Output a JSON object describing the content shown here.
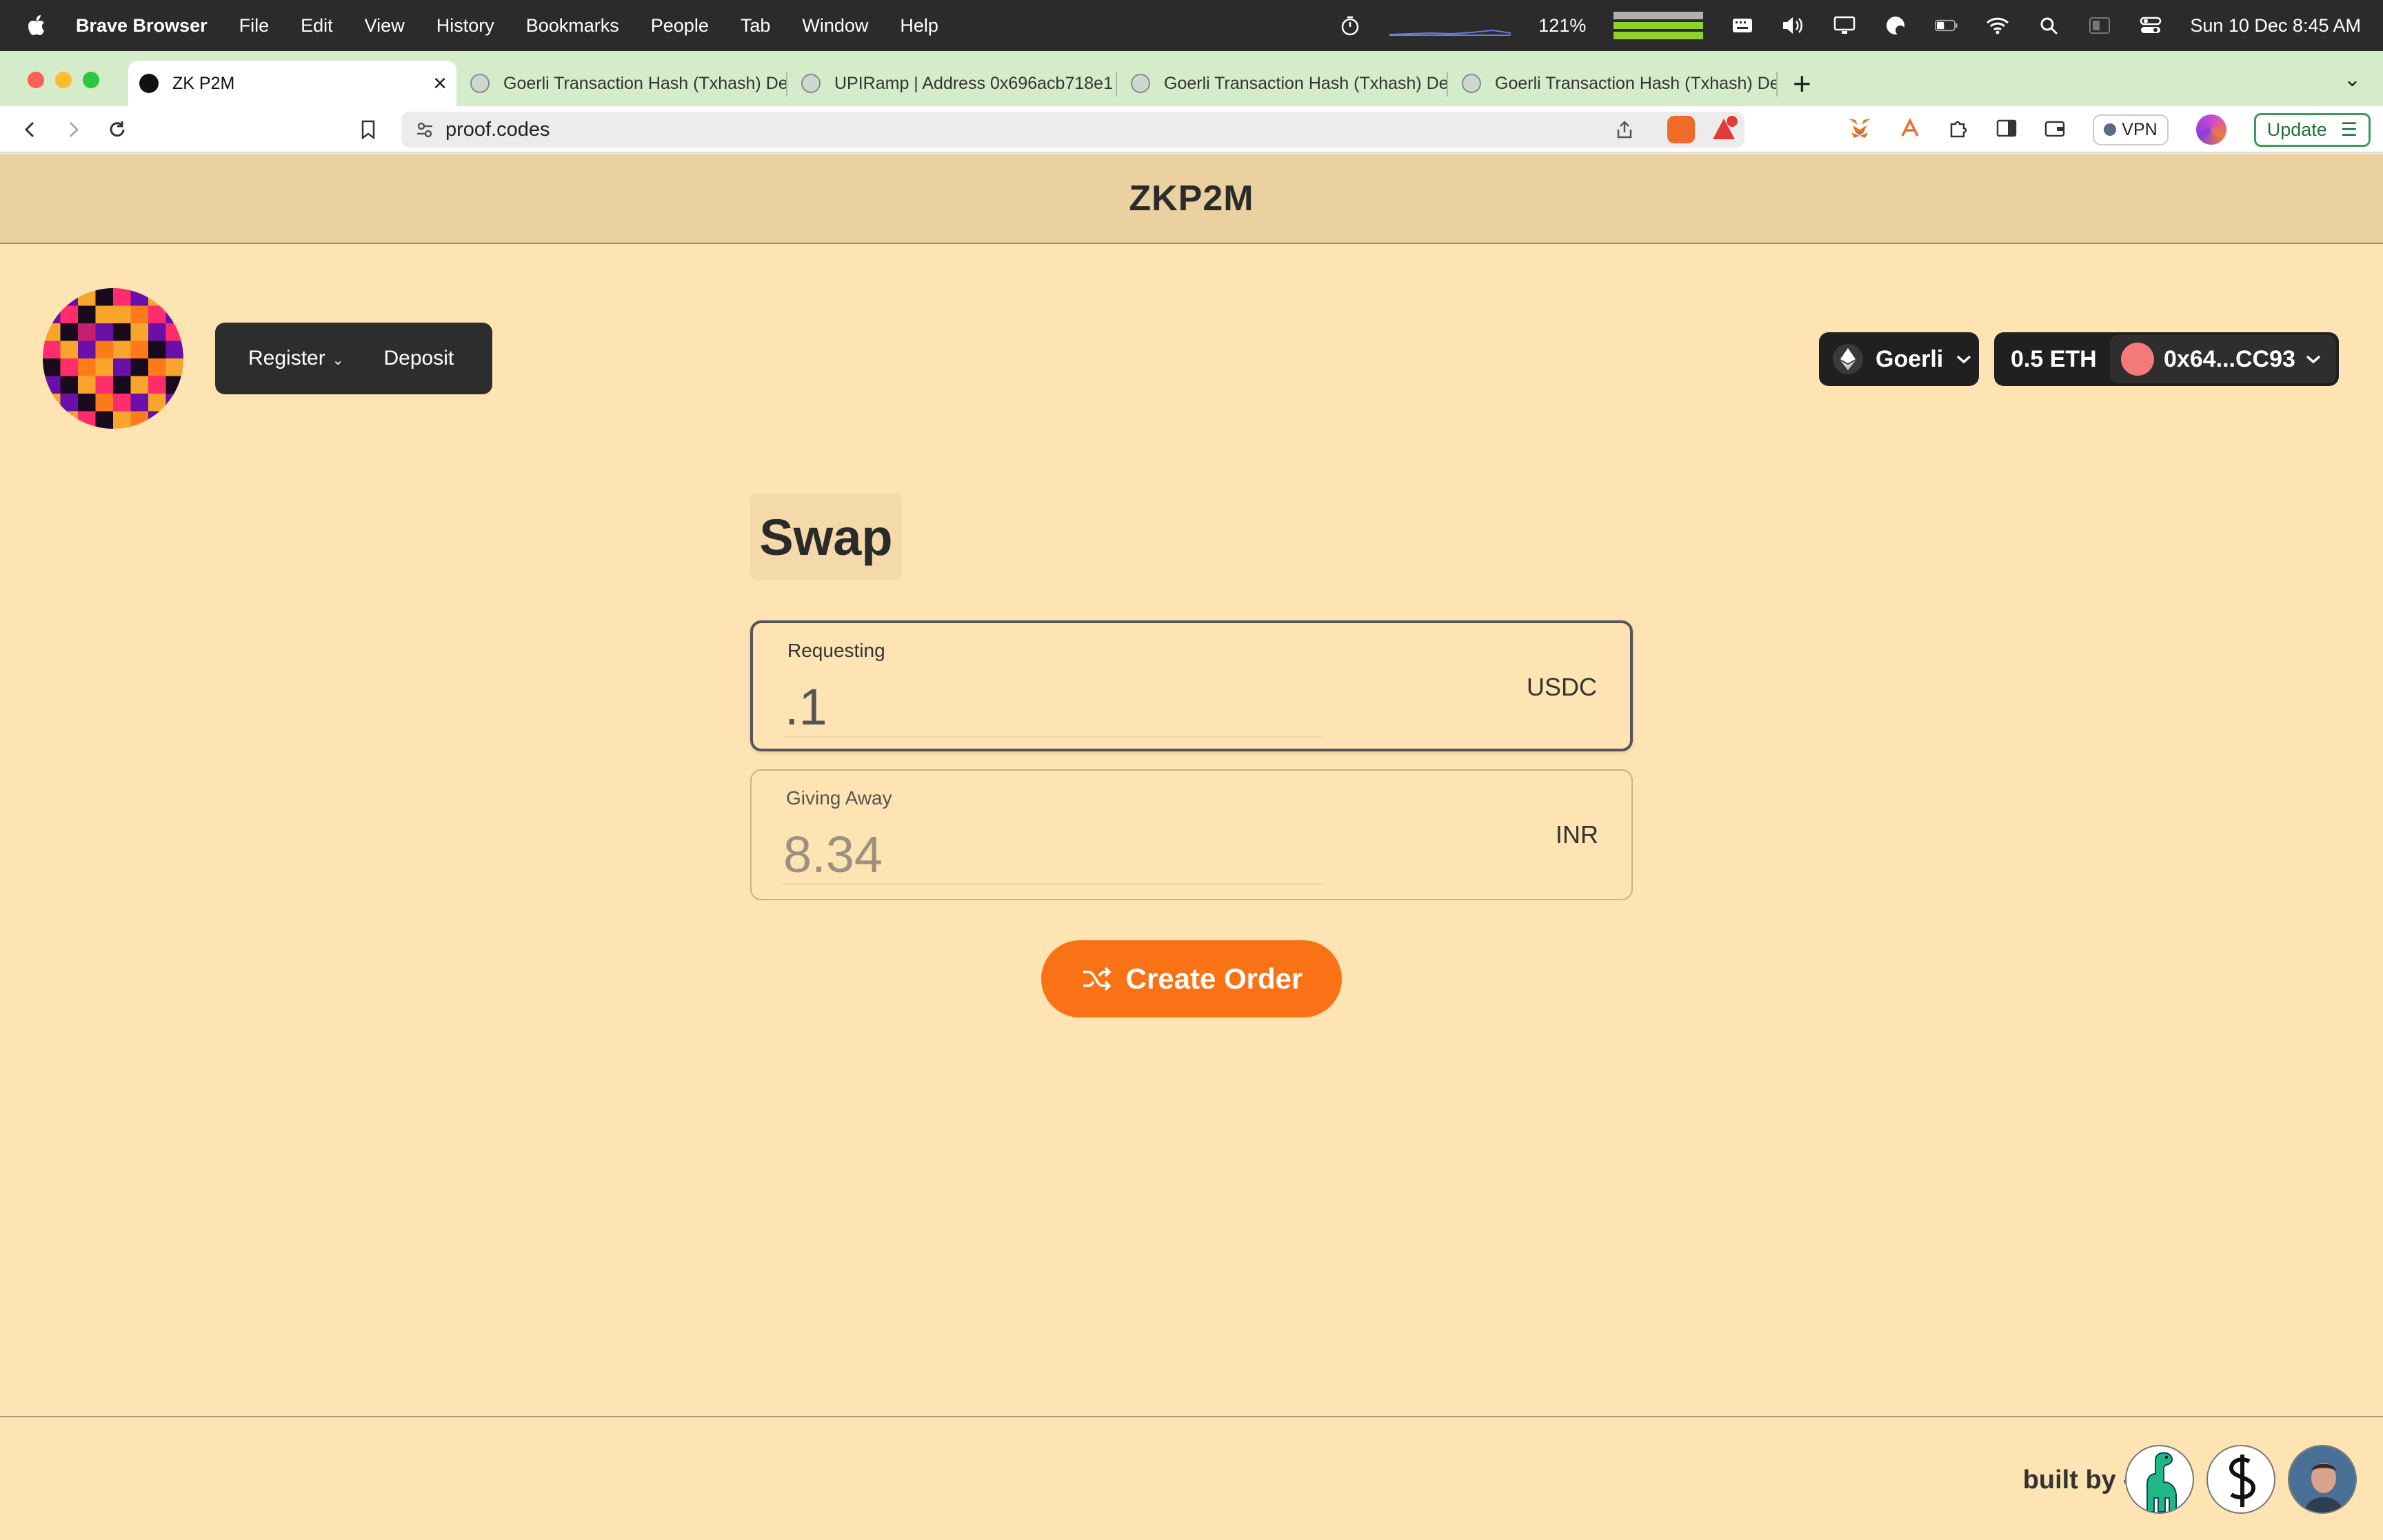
{
  "menubar": {
    "app": "Brave Browser",
    "items": [
      "File",
      "Edit",
      "View",
      "History",
      "Bookmarks",
      "People",
      "Tab",
      "Window",
      "Help"
    ],
    "stat_percent": "121%",
    "clock": "Sun 10 Dec  8:45 AM",
    "icons": [
      "stopwatch-icon",
      "keyboard-icon",
      "volume-icon",
      "display-icon",
      "cloud-icon",
      "battery-icon",
      "wifi-icon",
      "search-icon",
      "control-center-icon"
    ]
  },
  "tabs": [
    {
      "label": "ZK P2M",
      "active": true
    },
    {
      "label": "Goerli Transaction Hash (Txhash) De",
      "active": false
    },
    {
      "label": "UPIRamp | Address 0x696acb718e1",
      "active": false
    },
    {
      "label": "Goerli Transaction Hash (Txhash) De",
      "active": false
    },
    {
      "label": "Goerli Transaction Hash (Txhash) De",
      "active": false
    }
  ],
  "toolbar": {
    "url": "proof.codes",
    "vpn_label": "VPN",
    "update_label": "Update",
    "shield_badge": "1",
    "rewards_badge": "1"
  },
  "app": {
    "title": "ZKP2M",
    "nav": {
      "register": "Register",
      "deposit": "Deposit"
    },
    "network": "Goerli",
    "balance": "0.5 ETH",
    "address": "0x64...CC93"
  },
  "swap": {
    "title": "Swap",
    "requesting": {
      "label": "Requesting",
      "value": ".1",
      "currency": "USDC"
    },
    "giving": {
      "label": "Giving Away",
      "value": "8.34",
      "currency": "INR"
    },
    "button": "Create Order"
  },
  "footer": {
    "built_by": "built by -"
  },
  "colors": {
    "page_bg": "#fee4b3",
    "header_bg": "#ead19f",
    "accent": "#f97316",
    "dark_button": "#2d2d2d"
  }
}
